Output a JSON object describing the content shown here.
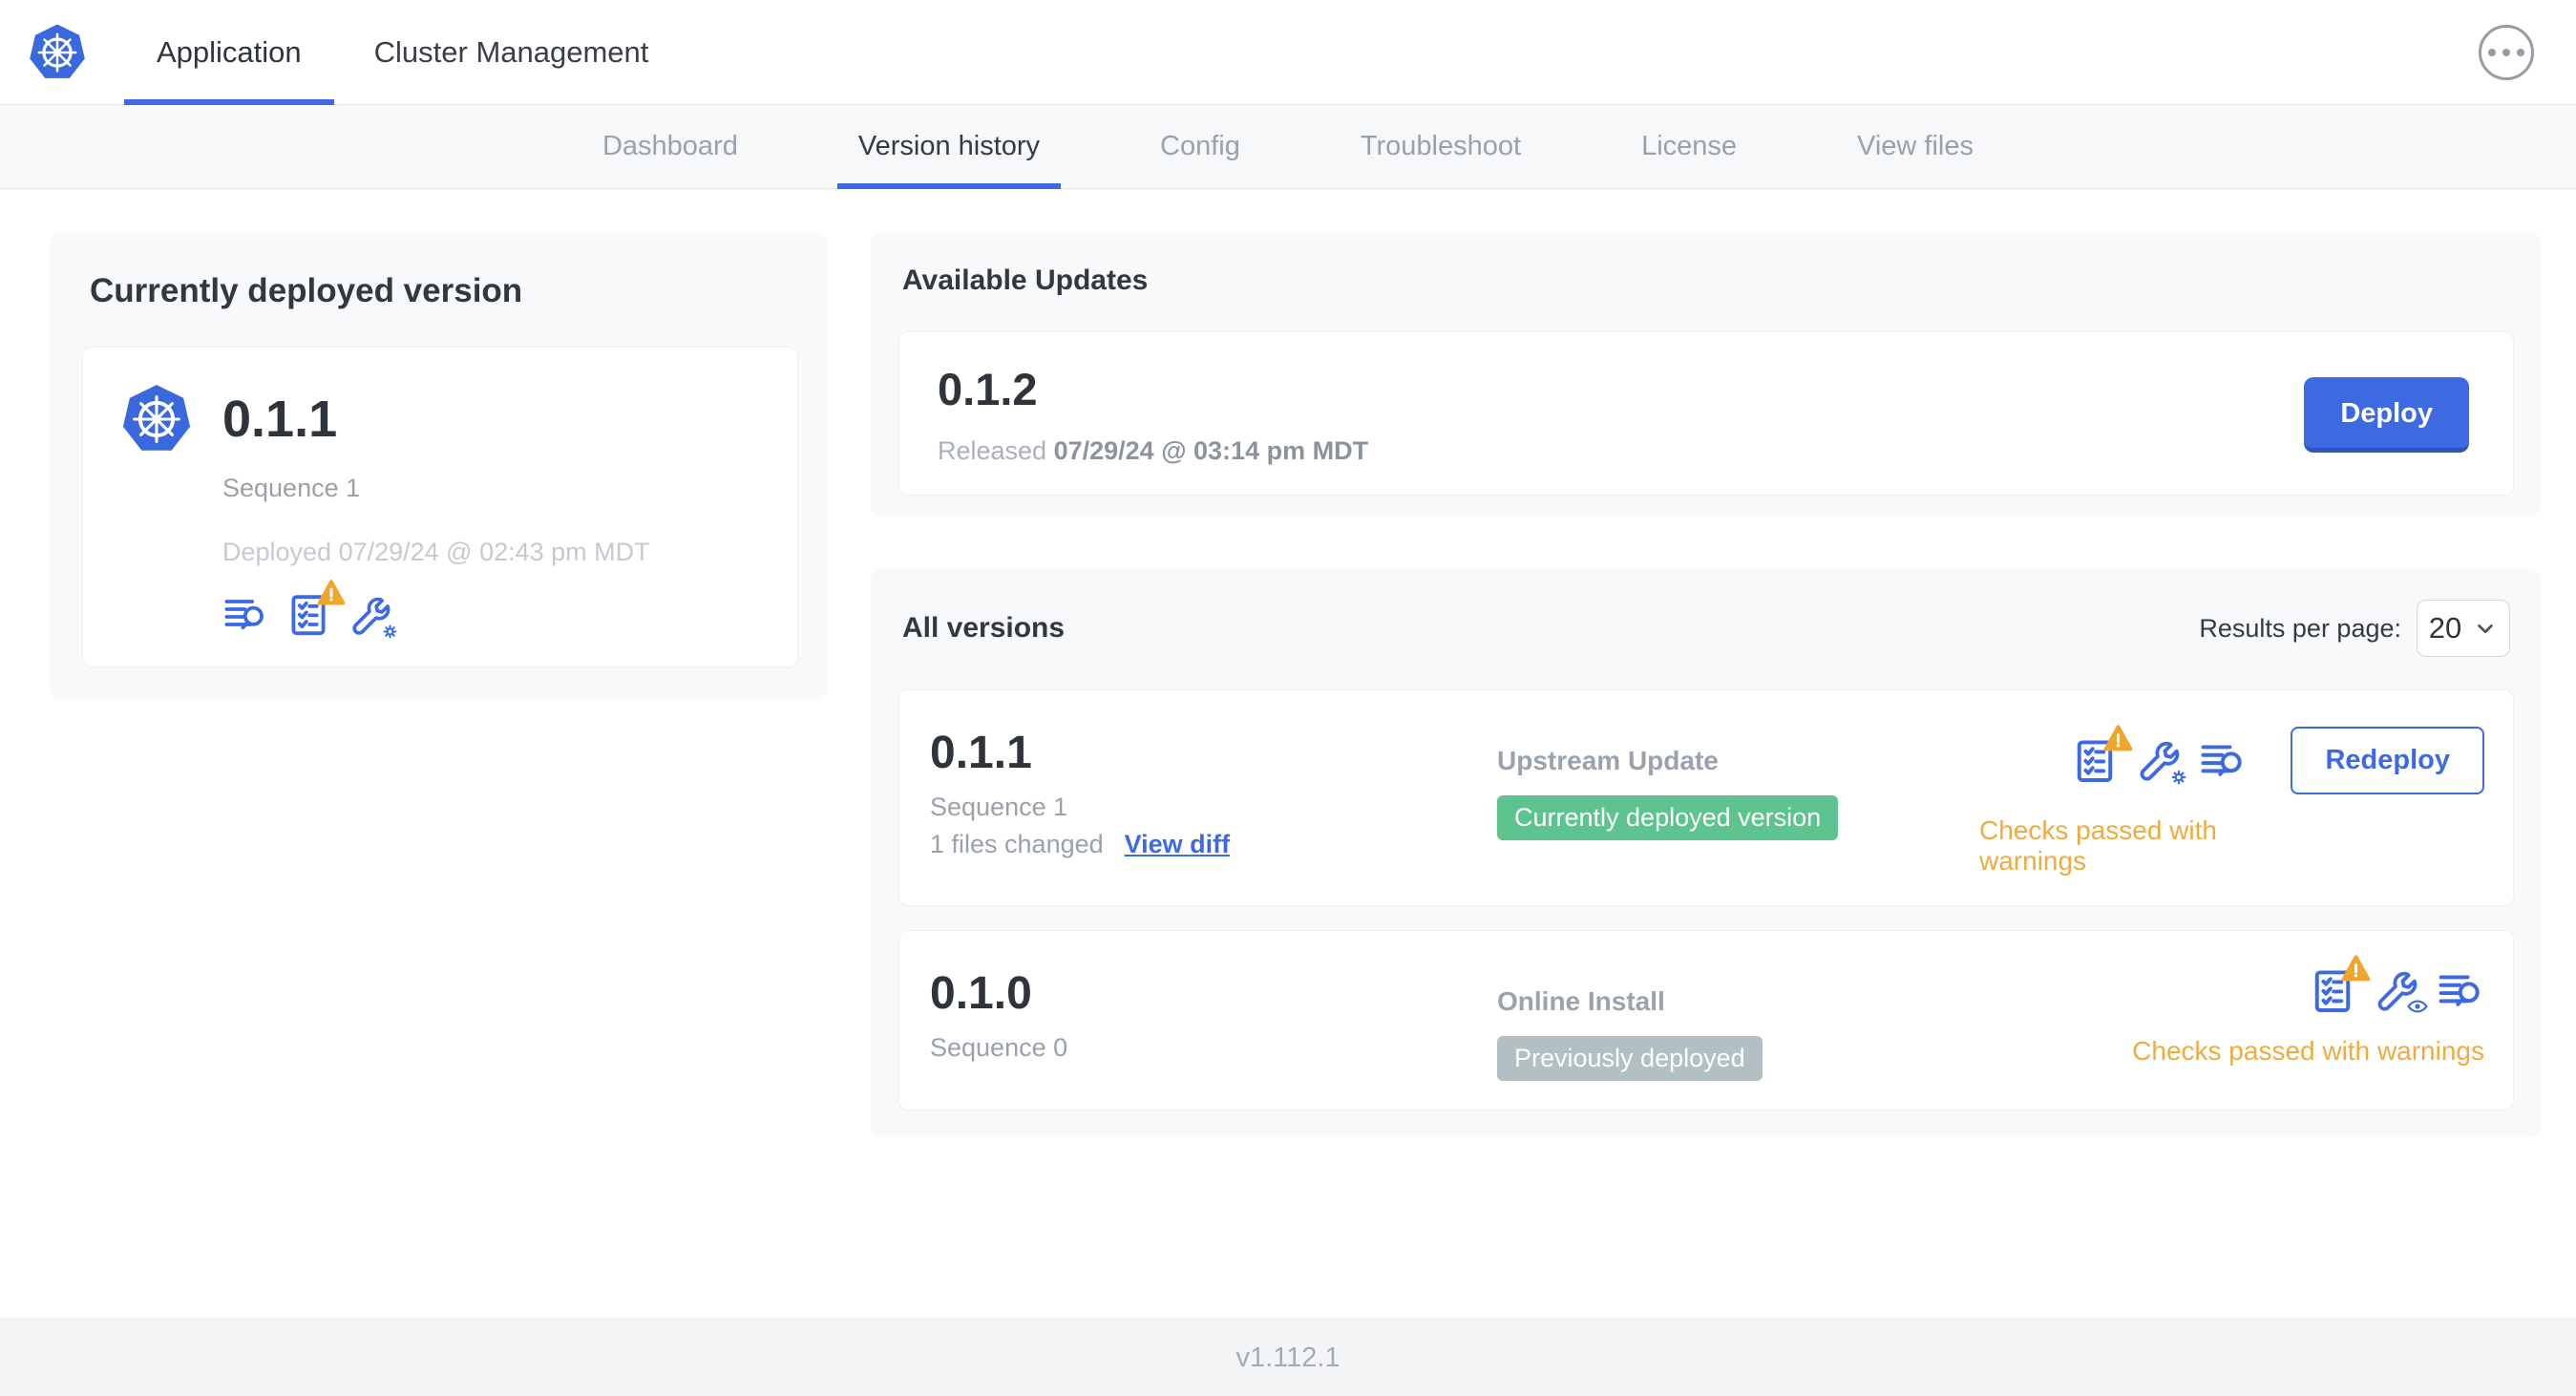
{
  "header": {
    "logo_icon": "kubernetes-logo",
    "tabs": [
      {
        "label": "Application"
      },
      {
        "label": "Cluster Management"
      }
    ],
    "active_tab": "Application",
    "menu_icon": "ellipsis-circle-icon"
  },
  "subnav": {
    "items": [
      {
        "label": "Dashboard"
      },
      {
        "label": "Version history"
      },
      {
        "label": "Config"
      },
      {
        "label": "Troubleshoot"
      },
      {
        "label": "License"
      },
      {
        "label": "View files"
      }
    ],
    "active_item": "Version history"
  },
  "deployed_card": {
    "title": "Currently deployed version",
    "version": "0.1.1",
    "sequence": "Sequence 1",
    "deployed_at": "Deployed 07/29/24 @ 02:43 pm MDT",
    "icons": [
      "diff-icon",
      "preflight-checks-warning-icon",
      "edit-config-icon"
    ]
  },
  "available_updates": {
    "title": "Available Updates",
    "update": {
      "version": "0.1.2",
      "released_label": "Released",
      "released_at": "07/29/24 @ 03:14 pm MDT",
      "deploy_label": "Deploy"
    }
  },
  "all_versions": {
    "title": "All versions",
    "results_per_page_label": "Results per page:",
    "results_per_page_value": "20",
    "rows": [
      {
        "version": "0.1.1",
        "sequence": "Sequence 1",
        "files_changed": "1 files changed",
        "view_diff_label": "View diff",
        "source": "Upstream Update",
        "badge": "Currently deployed version",
        "badge_style": "green",
        "icons": [
          "preflight-checks-warning-icon",
          "edit-config-icon",
          "diff-icon"
        ],
        "action_label": "Redeploy",
        "status": "Checks passed with warnings"
      },
      {
        "version": "0.1.0",
        "sequence": "Sequence 0",
        "source": "Online Install",
        "badge": "Previously deployed",
        "badge_style": "gray",
        "icons": [
          "preflight-checks-warning-icon",
          "view-config-icon",
          "diff-icon"
        ],
        "status": "Checks passed with warnings"
      }
    ]
  },
  "footer": {
    "version": "v1.112.1"
  },
  "colors": {
    "accent_blue": "#3d6ae0",
    "logo_blue": "#3a68dd",
    "badge_green": "#5ec48f",
    "badge_gray": "#b2bfc3",
    "warning_text_orange": "#eeab3e",
    "warning_triangle_orange": "#f0a62b"
  }
}
